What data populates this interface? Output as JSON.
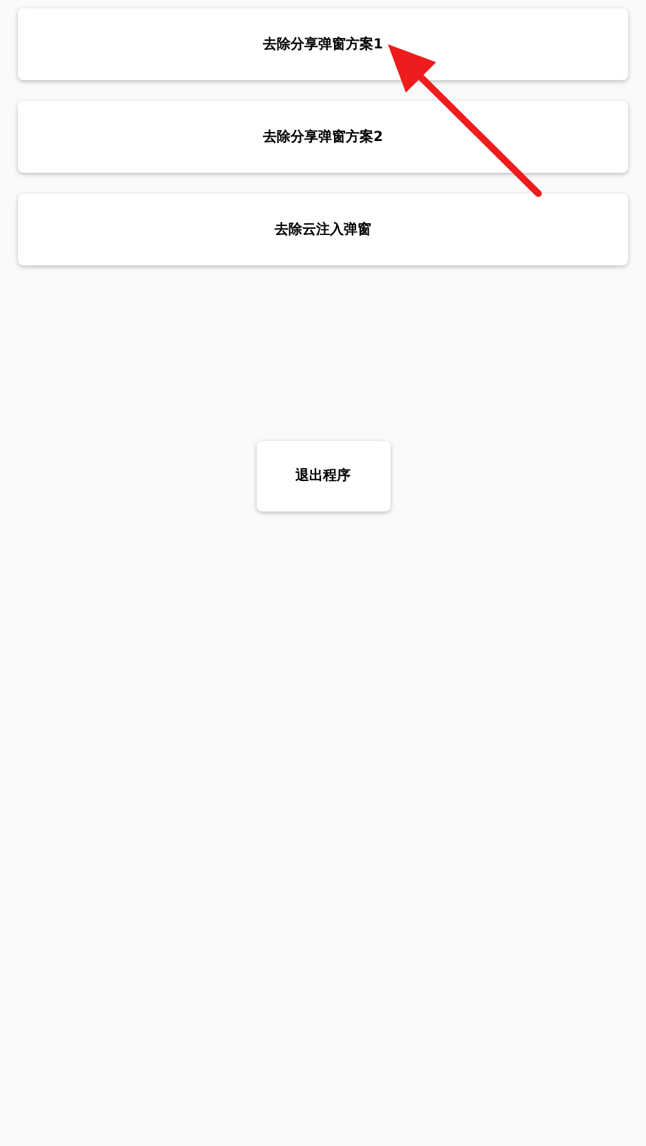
{
  "options": [
    {
      "label": "去除分享弹窗方案1"
    },
    {
      "label": "去除分享弹窗方案2"
    },
    {
      "label": "去除云注入弹窗"
    }
  ],
  "exit_button": {
    "label": "退出程序"
  }
}
